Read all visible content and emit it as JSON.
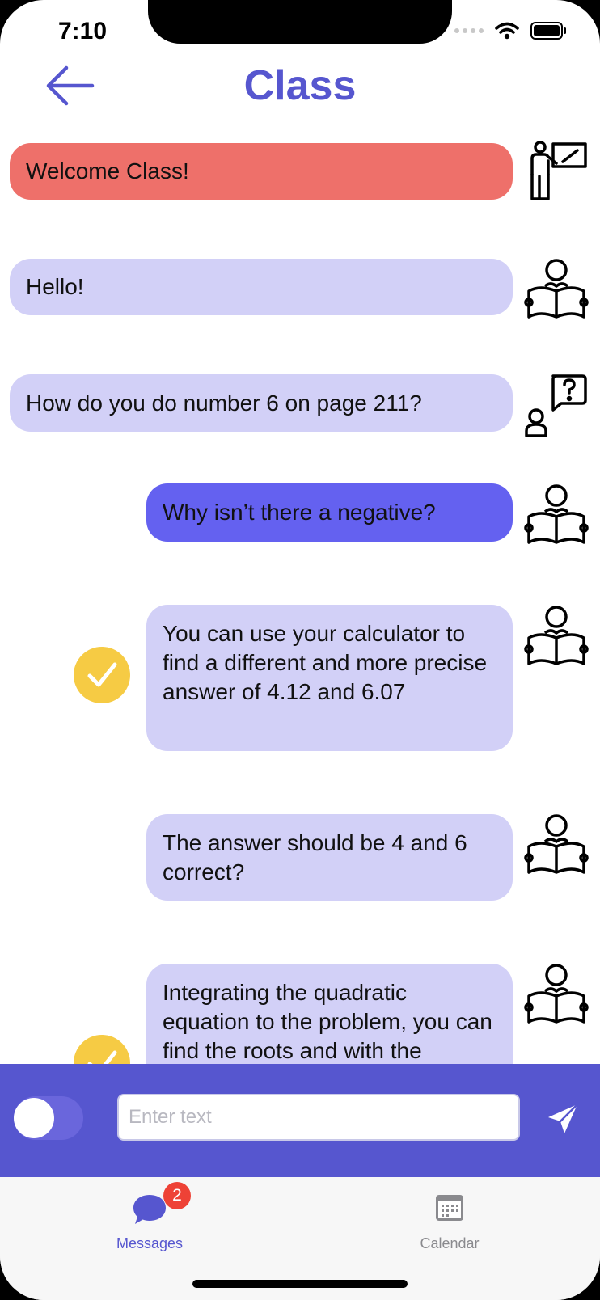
{
  "status_bar": {
    "time": "7:10"
  },
  "header": {
    "title": "Class"
  },
  "messages": [
    {
      "text": "Welcome Class!",
      "sender": "teacher",
      "style": "red",
      "avatar": "teacher-pointing-board-icon",
      "checked": false
    },
    {
      "text": "Hello!",
      "sender": "student",
      "style": "lavender",
      "avatar": "student-reading-icon",
      "checked": false
    },
    {
      "text": "How do you do number 6 on page 211?",
      "sender": "student",
      "style": "lavender",
      "avatar": "person-question-icon",
      "checked": false
    },
    {
      "text": "Why isn’t there a negative?",
      "sender": "student",
      "style": "blue",
      "avatar": "student-reading-icon",
      "checked": false
    },
    {
      "text": "You can use your calculator to find a different and more precise answer of 4.12 and 6.07",
      "sender": "student",
      "style": "lavender",
      "avatar": "student-reading-icon",
      "checked": true
    },
    {
      "text": "The answer should be 4 and 6 correct?",
      "sender": "student",
      "style": "lavender",
      "avatar": "student-reading-icon",
      "checked": false
    },
    {
      "text": "Integrating the quadratic equation to the problem, you can find the roots and with the",
      "sender": "student",
      "style": "lavender",
      "avatar": "student-reading-icon",
      "checked": true
    }
  ],
  "composer": {
    "placeholder": "Enter text",
    "toggle_on": false
  },
  "tabbar": {
    "tabs": [
      {
        "label": "Messages",
        "icon": "chat-bubble-icon",
        "badge": "2",
        "active": true
      },
      {
        "label": "Calendar",
        "icon": "calendar-icon",
        "active": false
      }
    ]
  },
  "colors": {
    "accent": "#5656cf",
    "teacher_bubble": "#ee706a",
    "student_bubble": "#d2d0f7",
    "selected_bubble": "#6461f0",
    "check": "#f6cb44",
    "badge": "#ee4236"
  }
}
